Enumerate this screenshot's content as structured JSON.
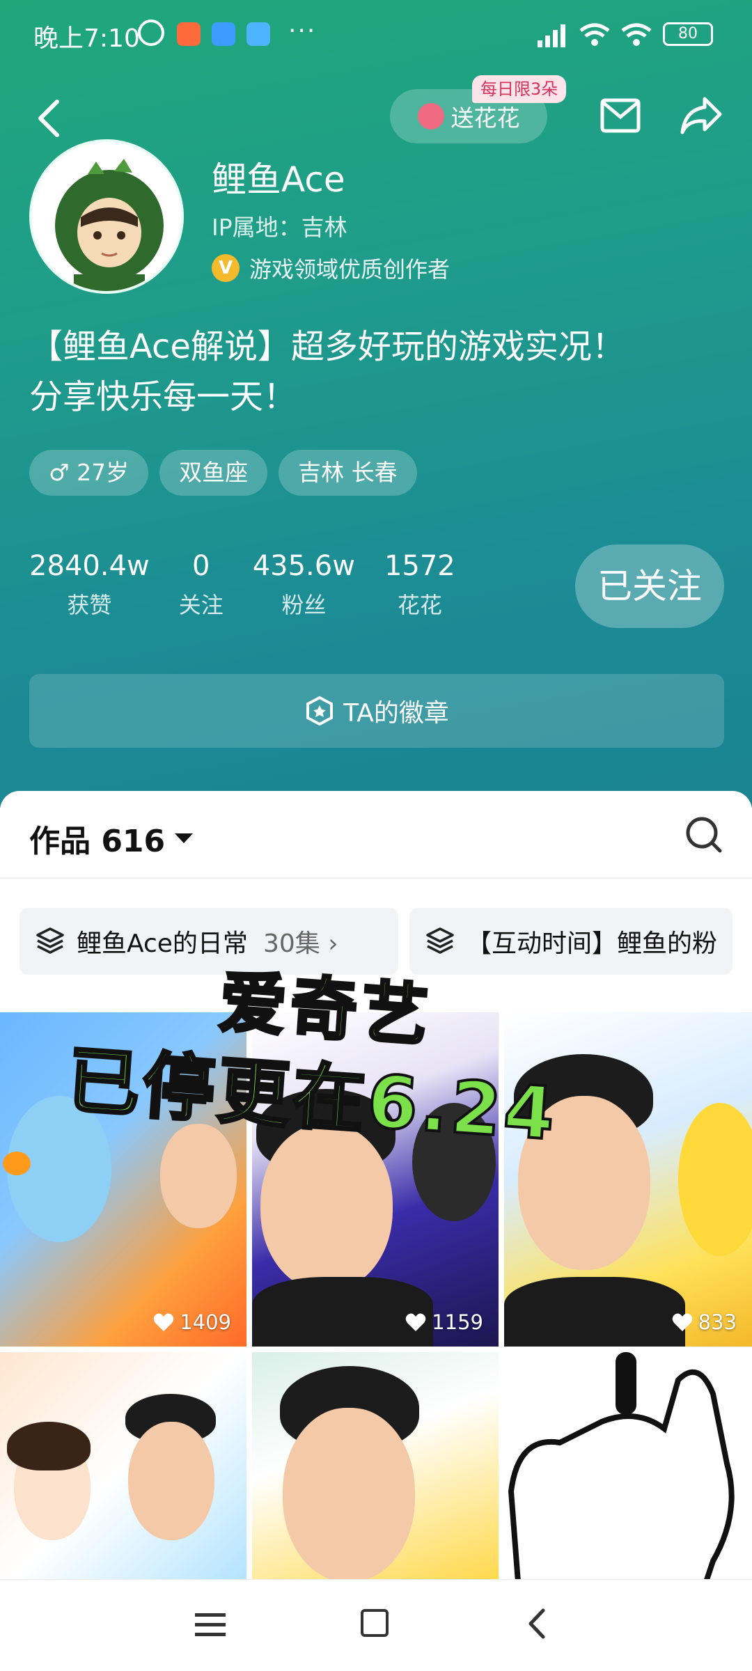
{
  "status_bar": {
    "time": "晚上7:10",
    "battery": "80",
    "dots": "···"
  },
  "header": {
    "flower_button_label": "送花花",
    "flower_badge": "每日限3朵"
  },
  "profile": {
    "name": "鲤鱼Ace",
    "ip_location": "IP属地：吉林",
    "creator_label": "游戏领域优质创作者",
    "verified_mark": "V",
    "bio_line1": "【鲤鱼Ace解说】超多好玩的游戏实况！",
    "bio_line2": "分享快乐每一天！",
    "tags": [
      "♂ 27岁",
      "双鱼座",
      "吉林 长春"
    ]
  },
  "stats": [
    {
      "value": "2840.4w",
      "label": "获赞"
    },
    {
      "value": "0",
      "label": "关注"
    },
    {
      "value": "435.6w",
      "label": "粉丝"
    },
    {
      "value": "1572",
      "label": "花花"
    }
  ],
  "follow_button": "已关注",
  "badge_bar": "TA的徽章",
  "works": {
    "title": "作品 616",
    "collections": [
      {
        "name": "鲤鱼Ace的日常",
        "count": "30集 ›"
      },
      {
        "name": "【互动时间】鲤鱼的粉",
        "count": ""
      }
    ],
    "videos": [
      {
        "likes": "1409"
      },
      {
        "likes": "1159"
      },
      {
        "likes": "833"
      },
      {
        "likes": ""
      },
      {
        "likes": ""
      },
      {
        "likes": ""
      }
    ]
  },
  "watermark": {
    "line1": "爱奇艺",
    "line2": "已停更在6.24"
  },
  "colors": {
    "hero_top": "#1fa77a",
    "hero_bottom": "#1a8392",
    "badge_pink": "#d6345c",
    "watermark_green": "#7be04a"
  }
}
